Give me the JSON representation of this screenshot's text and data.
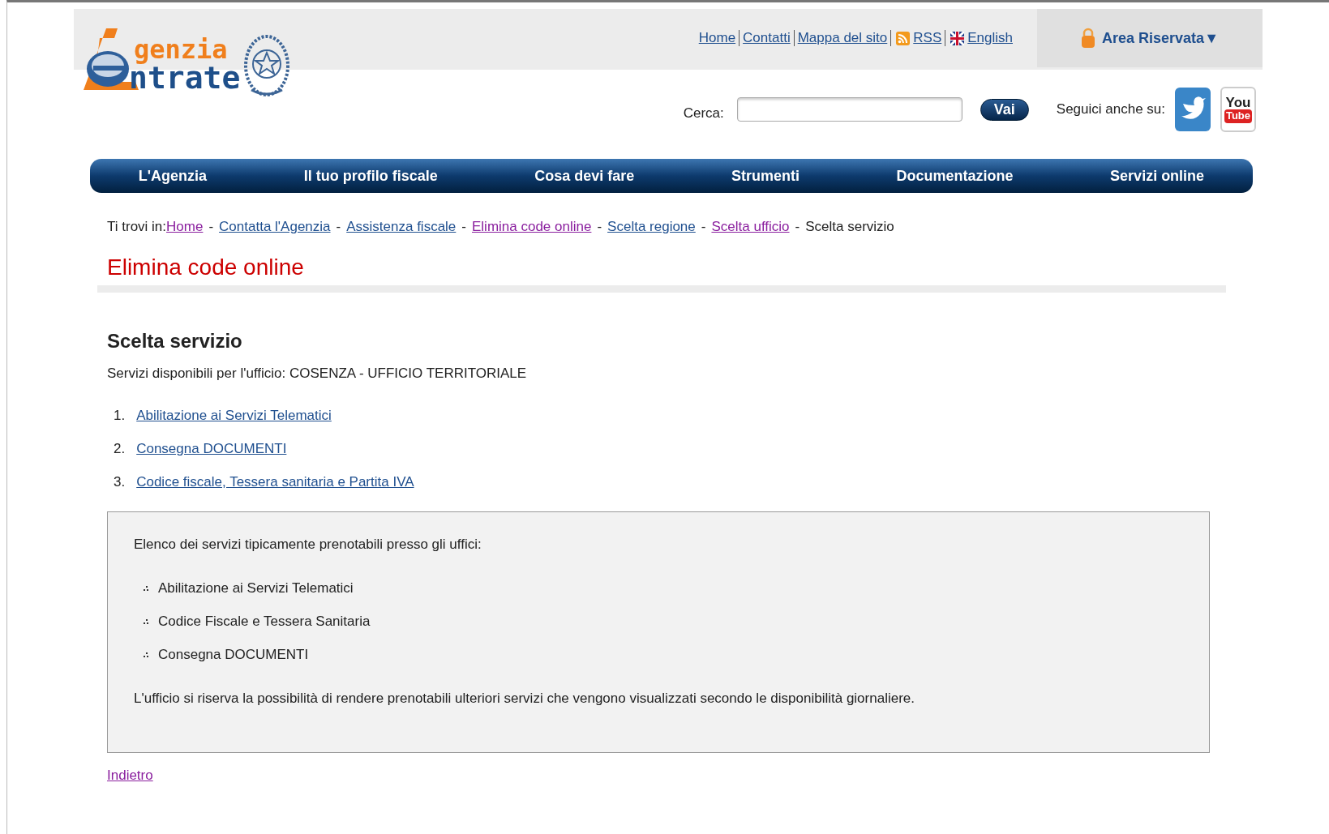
{
  "logo": {
    "line1": "genzia",
    "line2": "ntrate"
  },
  "top_links": [
    {
      "label": "Home",
      "kind": "text"
    },
    {
      "label": "Contatti",
      "kind": "text"
    },
    {
      "label": "Mappa del sito",
      "kind": "text"
    },
    {
      "label": "RSS",
      "kind": "rss"
    },
    {
      "label": "English",
      "kind": "flag"
    }
  ],
  "reserved_area": {
    "label": "Area Riservata▼"
  },
  "search": {
    "label": "Cerca:",
    "button": "Vai"
  },
  "social": {
    "label": "Seguici anche su:",
    "youtube_top": "You",
    "youtube_bottom": "Tube"
  },
  "nav": [
    "L'Agenzia",
    "Il tuo profilo fiscale",
    "Cosa devi fare",
    "Strumenti",
    "Documentazione",
    "Servizi online"
  ],
  "breadcrumb": {
    "prefix": "Ti trovi in:",
    "links": [
      {
        "label": "Home",
        "visited": true
      },
      {
        "label": "Contatta l'Agenzia",
        "visited": false
      },
      {
        "label": "Assistenza fiscale",
        "visited": false
      },
      {
        "label": "Elimina code online",
        "visited": true
      },
      {
        "label": "Scelta regione",
        "visited": false
      },
      {
        "label": "Scelta ufficio",
        "visited": true
      }
    ],
    "current": "Scelta servizio",
    "separator": "-"
  },
  "page_title": "Elimina code online",
  "section_title": "Scelta servizio",
  "description": "Servizi disponibili per l'ufficio: COSENZA - UFFICIO TERRITORIALE",
  "services": [
    {
      "number": "1.",
      "label": "Abilitazione ai Servizi Telematici"
    },
    {
      "number": "2.",
      "label": "Consegna DOCUMENTI"
    },
    {
      "number": "3.",
      "label": "Codice fiscale, Tessera sanitaria e Partita IVA"
    }
  ],
  "info_box": {
    "intro": "Elenco dei servizi tipicamente prenotabili presso gli uffici:",
    "items": [
      "Abilitazione ai Servizi Telematici",
      "Codice Fiscale e Tessera Sanitaria",
      "Consegna DOCUMENTI"
    ],
    "note": "L'ufficio si riserva la possibilità di rendere prenotabili ulteriori servizi che vengono visualizzati secondo le disponibilità giornaliere."
  },
  "back_link": {
    "label": "Indietro",
    "visited": true
  }
}
